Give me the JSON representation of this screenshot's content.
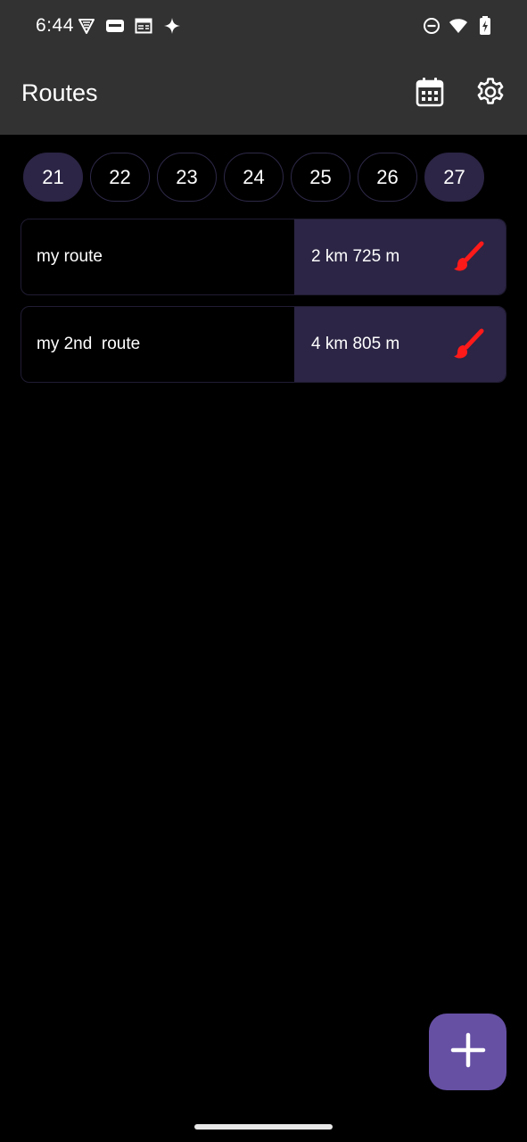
{
  "status_bar": {
    "time": "6:44",
    "left_icons": [
      "vpn-shield-icon",
      "comfy-app-icon",
      "browser-window-icon",
      "sparkle-icon"
    ],
    "right_icons": [
      "do-not-disturb-icon",
      "wifi-icon",
      "battery-charging-icon"
    ]
  },
  "app_bar": {
    "title": "Routes",
    "actions": [
      "calendar-icon",
      "gear-icon"
    ]
  },
  "days": [
    {
      "label": "21",
      "selected": true
    },
    {
      "label": "22",
      "selected": false
    },
    {
      "label": "23",
      "selected": false
    },
    {
      "label": "24",
      "selected": false
    },
    {
      "label": "25",
      "selected": false
    },
    {
      "label": "26",
      "selected": false
    },
    {
      "label": "27",
      "selected": true
    }
  ],
  "routes": [
    {
      "name": "my route",
      "distance": "2 km 725 m",
      "action_icon": "paintbrush-icon"
    },
    {
      "name": "my 2nd  route",
      "distance": "4 km 805 m",
      "action_icon": "paintbrush-icon"
    }
  ],
  "fab": {
    "icon": "plus-icon"
  },
  "colors": {
    "app_bar": "#323232",
    "background": "#000000",
    "chip_selected": "#2c2545",
    "distance_panel": "#2c2545",
    "brush": "#ff1a1a",
    "fab": "#6650a4"
  }
}
